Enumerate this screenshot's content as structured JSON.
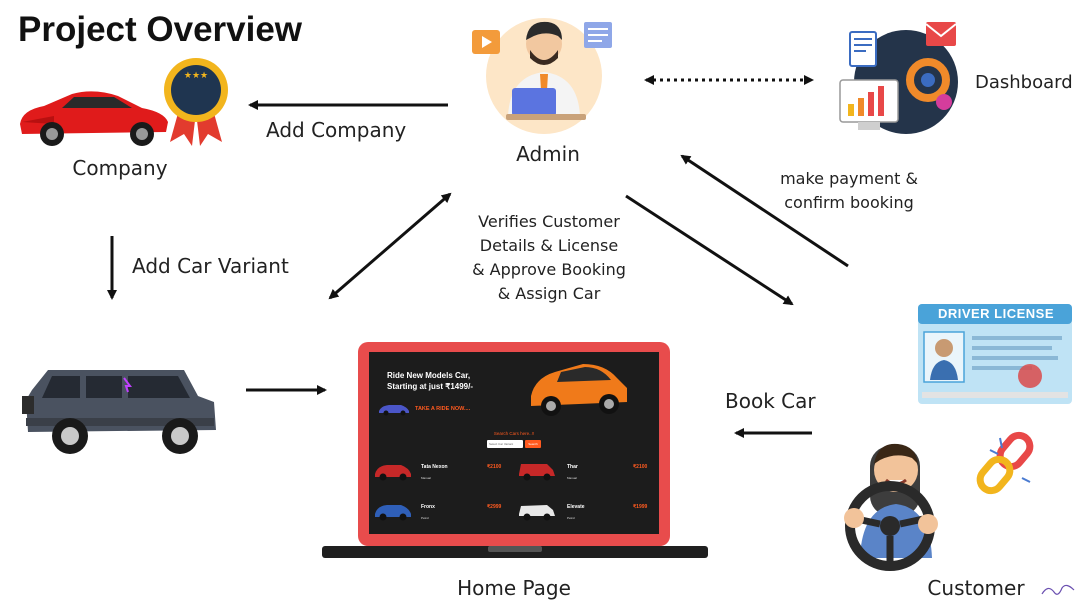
{
  "title": "Project Overview",
  "nodes": {
    "company": "Company",
    "admin": "Admin",
    "dashboard": "Dashboard",
    "home_page": "Home Page",
    "customer": "Customer"
  },
  "edges": {
    "add_company": "Add Company",
    "add_car_variant": "Add Car Variant",
    "book_car": "Book Car",
    "payment_line1": "make payment &",
    "payment_line2": "confirm booking",
    "verify_line1": "Verifies Customer",
    "verify_line2": "Details & License",
    "verify_line3": "& Approve Booking",
    "verify_line4": "& Assign Car"
  },
  "license": {
    "title": "DRIVER LICENSE"
  },
  "home_screen": {
    "hero_line1": "Ride New Models Car,",
    "hero_line2": "Starting at just ₹1499/-",
    "cta": "TAKE A RIDE NOW....",
    "search_title": "Search Cars here..!!",
    "search_placeholder": "Select Car Variant",
    "search_button": "Search",
    "cards": [
      {
        "name": "Tata Nexon",
        "price": "₹2100",
        "tag": "Manual"
      },
      {
        "name": "Thar",
        "price": "₹2100",
        "tag": "Manual"
      },
      {
        "name": "Fronx",
        "price": "₹2999",
        "tag": "Petrol"
      },
      {
        "name": "Elevate",
        "price": "₹1999",
        "tag": "Petrol"
      }
    ]
  },
  "colors": {
    "laptop_frame": "#e84c4c",
    "screen_bg": "#1c1c1c",
    "accent": "#ff5a1f",
    "license_blue": "#4aa3d9",
    "arrow": "#111111"
  }
}
